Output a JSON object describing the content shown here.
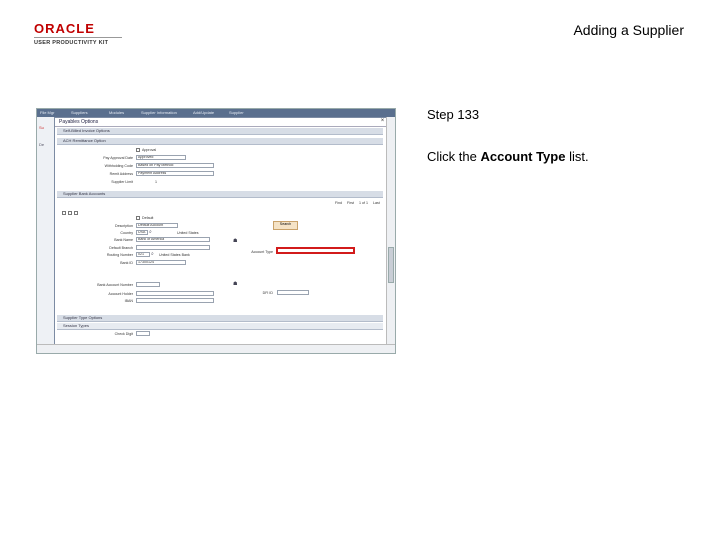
{
  "logo": {
    "brand": "ORACLE",
    "product": "USER PRODUCTIVITY KIT"
  },
  "header": {
    "title": "Adding a Supplier"
  },
  "step": {
    "label": "Step 133"
  },
  "instruction": {
    "prefix": "Click the ",
    "target": "Account Type",
    "suffix": " list."
  },
  "screenshot": {
    "nav": [
      "File Mgr",
      "Suppliers",
      "Modules",
      "Supplier Information",
      "Add/Update",
      "Supplier"
    ],
    "modal_title": "Payables Options",
    "sections": {
      "self_billed": "Self-Billed Invoice Options",
      "ach": "ACH Remittance Option",
      "bank": "Supplier Bank Accounts",
      "supplier_type": "Supplier Type Options",
      "session": "Session Types"
    },
    "fields": {
      "pay_approval": {
        "label": "Pay Approval Date",
        "value": "Approved"
      },
      "withholding": {
        "label": "Withholding Code",
        "value": "Based on Pay Method"
      },
      "remit": {
        "label": "Remit Address",
        "value": "Payment Address"
      },
      "supplier_limit": {
        "label": "Supplier Limit",
        "value": "1"
      },
      "description": {
        "label": "Description",
        "value": "Default Account"
      },
      "country": {
        "label": "Country",
        "value": "USA",
        "country_name": "United States"
      },
      "bank_name": {
        "label": "Bank Name",
        "value": "Bank of America"
      },
      "routing": {
        "label": "Routing Number",
        "value": "021"
      },
      "routing_bank": "United States Bank",
      "bank_id": {
        "label": "Bank ID",
        "value": "17300124"
      },
      "account_number": {
        "label": "Bank Account Number",
        "value": ""
      },
      "acct_holder": {
        "label": "Account Holder",
        "value": ""
      },
      "iban": {
        "label": "IBAN",
        "value": ""
      },
      "account_type": {
        "label": "Account Type",
        "value": ""
      },
      "dfi": {
        "label": "DFI ID",
        "value": ""
      },
      "default": "Default",
      "search": "Search",
      "check_digit": "Check Digit"
    },
    "grid_nav": [
      "Find",
      "First",
      "1 of 1",
      "Last"
    ]
  }
}
